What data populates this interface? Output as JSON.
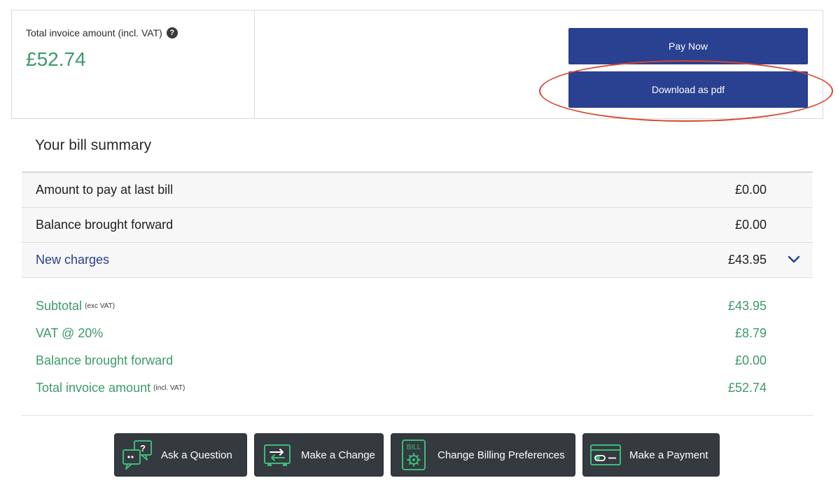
{
  "invoice": {
    "total_label": "Total invoice amount (incl. VAT)",
    "help_glyph": "?",
    "total_value": "£52.74",
    "pay_now_label": "Pay Now",
    "download_label": "Download as pdf"
  },
  "summary": {
    "title": "Your bill summary",
    "rows": [
      {
        "label": "Amount to pay at last bill",
        "value": "£0.00"
      },
      {
        "label": "Balance brought forward",
        "value": "£0.00"
      },
      {
        "label": "New charges",
        "value": "£43.95"
      }
    ],
    "totals": [
      {
        "label": "Subtotal",
        "note": "(exc VAT)",
        "value": "£43.95"
      },
      {
        "label": "VAT @ 20%",
        "note": "",
        "value": "£8.79"
      },
      {
        "label": "Balance brought forward",
        "note": "",
        "value": "£0.00"
      },
      {
        "label": "Total invoice amount",
        "note": "(incl. VAT)",
        "value": "£52.74"
      }
    ]
  },
  "actions": [
    {
      "label": "Ask a Question",
      "icon": "question-chat-icon"
    },
    {
      "label": "Make a Change",
      "icon": "exchange-icon"
    },
    {
      "label": "Change Billing Preferences",
      "icon": "bill-settings-icon",
      "icon_text": "BILL"
    },
    {
      "label": "Make a Payment",
      "icon": "card-icon"
    }
  ],
  "colors": {
    "primary": "#2a4090",
    "accent_green": "#3d9a6a",
    "highlight": "#d9452c",
    "action_bg": "#343a3f"
  }
}
